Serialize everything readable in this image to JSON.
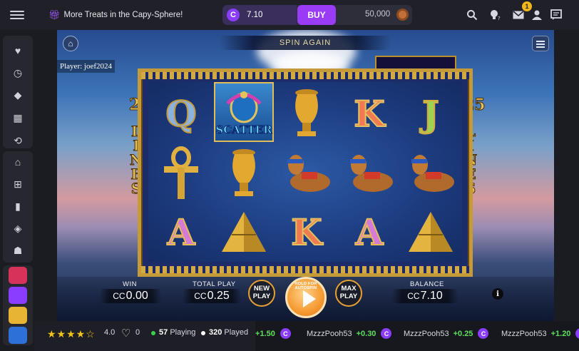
{
  "topbar": {
    "promo_text": "More Treats in the Capy-Sphere!",
    "coin_balance": "7.10",
    "buy_label": "BUY",
    "gold_balance": "50,000",
    "notification_count": "1",
    "icons": [
      "search-icon",
      "lightbulb-icon",
      "mail-icon",
      "user-icon",
      "chat-icon"
    ]
  },
  "sidebar": {
    "items": [
      {
        "name": "favorites",
        "icon": "heart-icon",
        "glyph": "♥"
      },
      {
        "name": "recent",
        "icon": "clock-icon",
        "glyph": "◷"
      },
      {
        "name": "vip",
        "icon": "diamond-icon",
        "glyph": "◆"
      },
      {
        "name": "store",
        "icon": "store-icon",
        "glyph": "▦"
      },
      {
        "name": "logout",
        "icon": "exit-icon",
        "glyph": "⟲"
      },
      {
        "name": "home",
        "icon": "home-icon",
        "glyph": "⌂"
      },
      {
        "name": "games",
        "icon": "gamepad-icon",
        "glyph": "⊞"
      },
      {
        "name": "leaderboard",
        "icon": "bar-chart-icon",
        "glyph": "▮"
      },
      {
        "name": "rewards",
        "icon": "layers-icon",
        "glyph": "◈"
      },
      {
        "name": "community",
        "icon": "people-icon",
        "glyph": "☗"
      }
    ],
    "game_thumb_colors": [
      "#d7325a",
      "#8a3cff",
      "#e7b433",
      "#2c70d8"
    ]
  },
  "game": {
    "banner_text": "SPIN AGAIN",
    "player_label": "Player: joef2024",
    "lines_number": "25",
    "lines_word": "LINES",
    "scatter_label": "SCATTER",
    "reels": [
      [
        "Q",
        "A-ankh",
        "A"
      ],
      [
        "SCATTER",
        "urn",
        "pyramid"
      ],
      [
        "urn",
        "camel",
        "K"
      ],
      [
        "K",
        "camel",
        "A"
      ],
      [
        "J",
        "camel",
        "pyramid"
      ]
    ],
    "controls": {
      "win_label": "WIN",
      "win_value": "0.00",
      "total_play_label": "TOTAL PLAY",
      "total_play_value": "0.25",
      "currency": "CC",
      "new_play_label_1": "NEW",
      "new_play_label_2": "PLAY",
      "autospin_hint": "HOLD FOR AUTOSPIN",
      "max_play_label_1": "MAX",
      "max_play_label_2": "PLAY",
      "balance_label": "BALANCE",
      "balance_value": "7.10",
      "info_label": "i"
    }
  },
  "bottombar": {
    "stars_text": "★★★★☆",
    "rating": "4.0",
    "likes": "0",
    "playing_count": "57",
    "playing_label": "Playing",
    "played_count": "320",
    "played_label": "Played",
    "ticker": [
      {
        "user": "",
        "amount": "+1.50"
      },
      {
        "user": "MzzzPooh53",
        "amount": "+0.30"
      },
      {
        "user": "MzzzPooh53",
        "amount": "+0.25"
      },
      {
        "user": "MzzzPooh53",
        "amount": "+1.20"
      }
    ]
  }
}
